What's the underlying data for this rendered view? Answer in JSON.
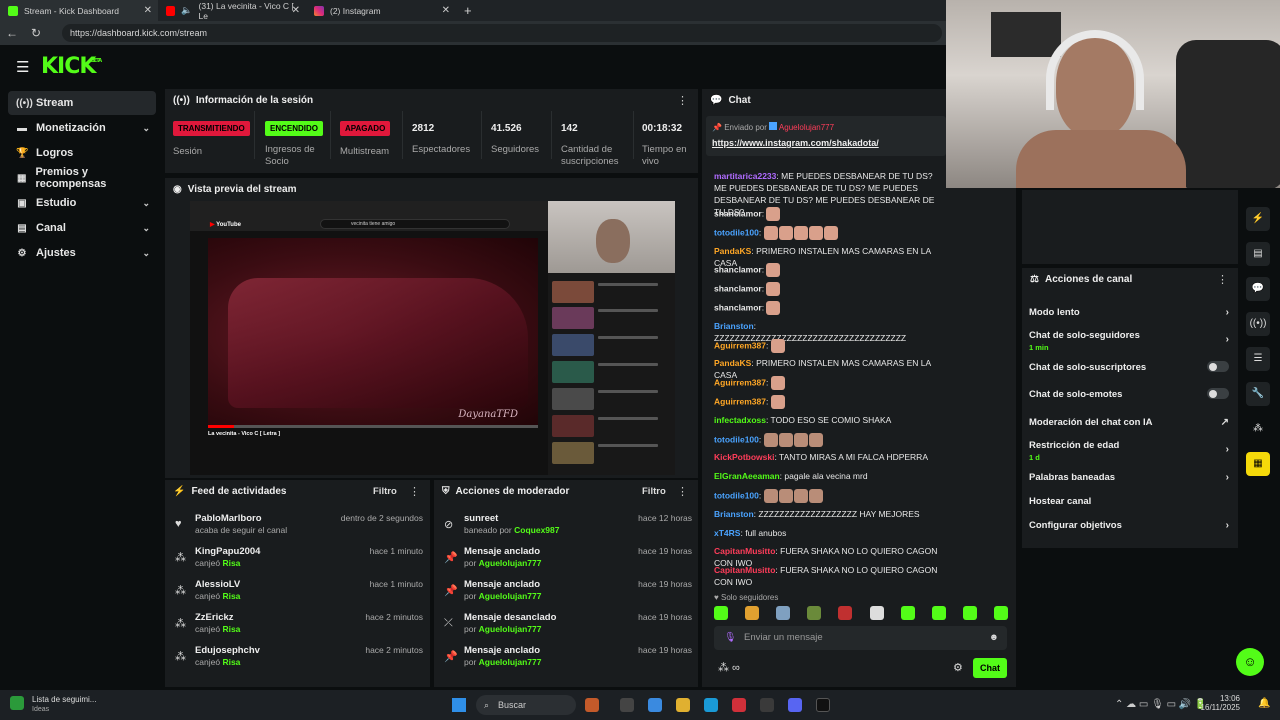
{
  "browser": {
    "tabs": [
      {
        "label": "Stream - Kick Dashboard"
      },
      {
        "label": "(31) La vecinita - Vico C [ Le"
      },
      {
        "label": "(2) Instagram"
      }
    ],
    "url": "https://dashboard.kick.com/stream"
  },
  "app": {
    "logo": "KICK",
    "logo_badge": "BETA"
  },
  "sidebar": {
    "items": [
      {
        "label": "Stream"
      },
      {
        "label": "Monetización"
      },
      {
        "label": "Logros"
      },
      {
        "label": "Premios y recompensas"
      },
      {
        "label": "Estudio"
      },
      {
        "label": "Canal"
      },
      {
        "label": "Ajustes"
      }
    ]
  },
  "session": {
    "title": "Información de la sesión",
    "stats": [
      {
        "value": "TRANSMITIENDO",
        "label": "Sesión",
        "color": "#e0183b"
      },
      {
        "value": "ENCENDIDO",
        "label": "Ingresos de Socio",
        "color": "#53fc18"
      },
      {
        "value": "APAGADO",
        "label": "Multistream",
        "color": "#e0183b"
      },
      {
        "value": "2812",
        "label": "Espectadores"
      },
      {
        "value": "41.526",
        "label": "Seguidores"
      },
      {
        "value": "142",
        "label": "Cantidad de suscripciones"
      },
      {
        "value": "00:18:32",
        "label": "Tiempo en vivo"
      }
    ]
  },
  "preview": {
    "title": "Vista previa del stream",
    "search_text": "vecinita tiene amigo",
    "video_title": "La vecinita - Vico C [ Letra ]",
    "watermark": "DayanaTFD"
  },
  "feed": {
    "title": "Feed de actividades",
    "filter": "Filtro",
    "items": [
      {
        "name": "PabloMarlboro",
        "sub": "acaba de seguir el canal",
        "highlight": "",
        "time": "dentro de 2 segundos"
      },
      {
        "name": "KingPapu2004",
        "sub": "canjeó",
        "highlight": "Risa",
        "time": "hace 1 minuto"
      },
      {
        "name": "AlessioLV",
        "sub": "canjeó",
        "highlight": "Risa",
        "time": "hace 1 minuto"
      },
      {
        "name": "ZzErickz",
        "sub": "canjeó",
        "highlight": "Risa",
        "time": "hace 2 minutos"
      },
      {
        "name": "Edujosephchv",
        "sub": "canjeó",
        "highlight": "Risa",
        "time": "hace 2 minutos"
      }
    ]
  },
  "mod": {
    "title": "Acciones de moderador",
    "filter": "Filtro",
    "items": [
      {
        "name": "sunreet",
        "sub": "baneado por",
        "highlight": "Coquex987",
        "time": "hace 12 horas"
      },
      {
        "name": "Mensaje anclado",
        "sub": "por",
        "highlight": "Aguelolujan777",
        "time": "hace 19 horas"
      },
      {
        "name": "Mensaje anclado",
        "sub": "por",
        "highlight": "Aguelolujan777",
        "time": "hace 19 horas"
      },
      {
        "name": "Mensaje desanclado",
        "sub": "por",
        "highlight": "Aguelolujan777",
        "time": "hace 19 horas"
      },
      {
        "name": "Mensaje anclado",
        "sub": "por",
        "highlight": "Aguelolujan777",
        "time": "hace 19 horas"
      }
    ]
  },
  "chat": {
    "title": "Chat",
    "pinned_by_label": "Enviado por",
    "pinned_by": "Aguelolujan777",
    "pinned_link": "https://www.instagram.com/shakadota/",
    "messages": [
      {
        "user": "martitarica2233",
        "color": "#b06bff",
        "text": "ME PUEDES DESBANEAR DE TU DS? ME PUEDES DESBANEAR DE TU DS? ME PUEDES DESBANEAR DE TU DS? ME PUEDES DESBANEAR DE TU DS?",
        "emotes": 0
      },
      {
        "user": "shanclamor",
        "color": "#e8e8e8",
        "text": "",
        "emotes": 1
      },
      {
        "user": "totodile100",
        "color": "#4aa3ff",
        "text": "",
        "emotes": 5
      },
      {
        "user": "PandaKS",
        "color": "#ffa726",
        "text": "PRIMERO INSTALEN MAS CAMARAS EN LA CASA",
        "emotes": 0
      },
      {
        "user": "shanclamor",
        "color": "#e8e8e8",
        "text": "",
        "emotes": 1
      },
      {
        "user": "shanclamor",
        "color": "#e8e8e8",
        "text": "",
        "emotes": 1
      },
      {
        "user": "shanclamor",
        "color": "#e8e8e8",
        "text": "",
        "emotes": 1
      },
      {
        "user": "Brianston",
        "color": "#4aa3ff",
        "text": "ZZZZZZZZZZZZZZZZZZZZZZZZZZZZZZZZZZZZZ",
        "emotes": 0
      },
      {
        "user": "Aguirrem387",
        "color": "#ffa726",
        "text": "",
        "emotes": 1
      },
      {
        "user": "PandaKS",
        "color": "#ffa726",
        "text": "PRIMERO INSTALEN MAS CAMARAS EN LA CASA",
        "emotes": 0
      },
      {
        "user": "Aguirrem387",
        "color": "#ffa726",
        "text": "",
        "emotes": 1
      },
      {
        "user": "Aguirrem387",
        "color": "#ffa726",
        "text": "",
        "emotes": 1
      },
      {
        "user": "infectadxoss",
        "color": "#53fc18",
        "text": "TODO ESO SE COMIO SHAKA",
        "emotes": 0
      },
      {
        "user": "totodile100",
        "color": "#4aa3ff",
        "text": "",
        "emotes": 4
      },
      {
        "user": "KickPotbowski",
        "color": "#ff3d5a",
        "text": "TANTO MIRAS A MI FALCA HDPERRA",
        "emotes": 0
      },
      {
        "user": "ElGranAeeaman",
        "color": "#53fc18",
        "text": "pagale ala vecina mrd",
        "emotes": 0
      },
      {
        "user": "totodile100",
        "color": "#4aa3ff",
        "text": "",
        "emotes": 4
      },
      {
        "user": "Brianston",
        "color": "#4aa3ff",
        "text": "ZZZZZZZZZZZZZZZZZZZ HAY MEJORES",
        "emotes": 0
      },
      {
        "user": "xT4RS",
        "color": "#4aa3ff",
        "text": "full anubos",
        "emotes": 0
      },
      {
        "user": "CapitanMusitto",
        "color": "#ff3d5a",
        "text": "FUERA SHAKA NO LO QUIERO CAGON CON IWO",
        "emotes": 0
      },
      {
        "user": "CapitanMusitto",
        "color": "#ff3d5a",
        "text": "FUERA SHAKA NO LO QUIERO CAGON CON IWO",
        "emotes": 0
      }
    ],
    "followers_only": "Solo seguidores",
    "input_placeholder": "Enviar un mensaje",
    "send_label": "Chat"
  },
  "channel_actions": {
    "title": "Acciones de canal",
    "items": [
      {
        "label": "Modo lento",
        "sub": "",
        "control": "chevron"
      },
      {
        "label": "Chat de solo-seguidores",
        "sub": "1 min",
        "control": "chevron"
      },
      {
        "label": "Chat de solo-suscriptores",
        "sub": "",
        "control": "toggle"
      },
      {
        "label": "Chat de solo-emotes",
        "sub": "",
        "control": "toggle"
      },
      {
        "label": "Moderación del chat con IA",
        "sub": "",
        "control": "external"
      },
      {
        "label": "Restricción de edad",
        "sub": "1 d",
        "control": "chevron"
      },
      {
        "label": "Palabras baneadas",
        "sub": "",
        "control": "chevron"
      },
      {
        "label": "Hostear canal",
        "sub": "",
        "control": "none"
      },
      {
        "label": "Configurar objetivos",
        "sub": "",
        "control": "chevron"
      }
    ]
  },
  "taskbar": {
    "widget_title": "Lista de seguimi...",
    "widget_sub": "Ideas",
    "search_label": "Buscar",
    "time": "13:06",
    "date": "16/11/2025"
  },
  "colors": {
    "accent": "#53fc18",
    "live": "#e0183b",
    "panel": "#191c1e"
  }
}
